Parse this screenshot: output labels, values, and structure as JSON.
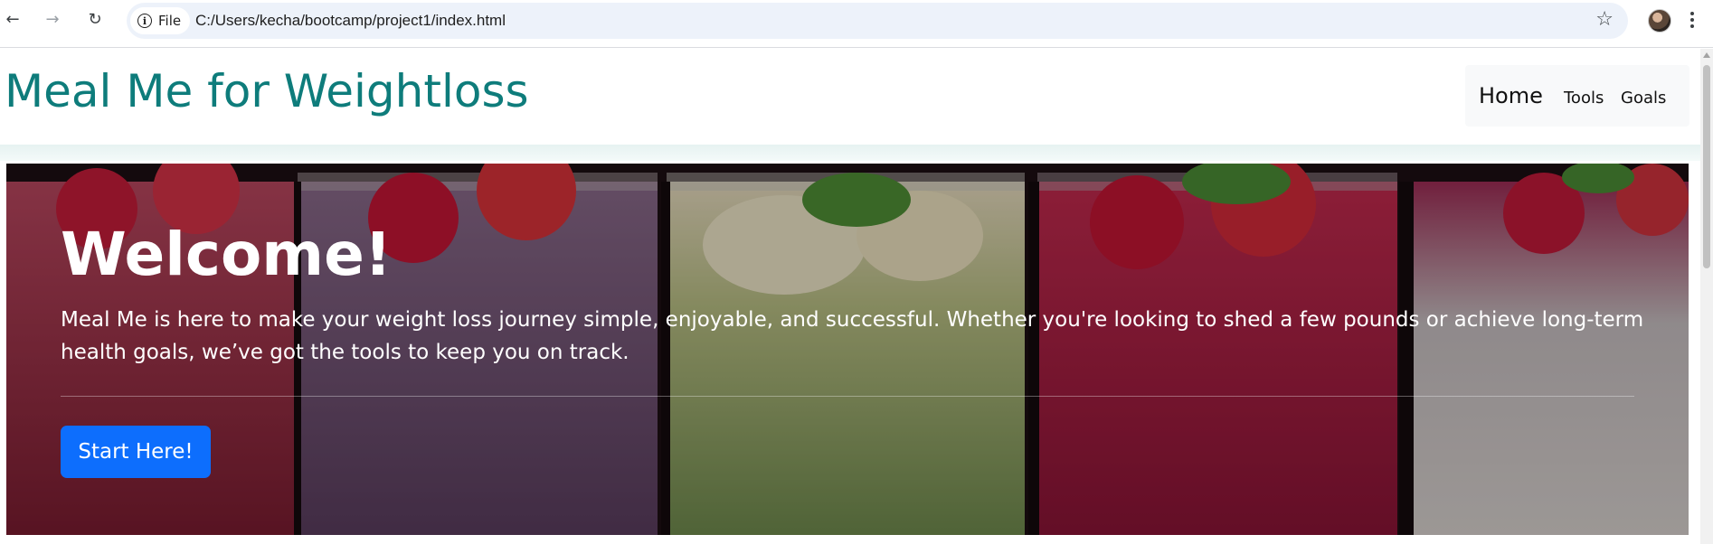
{
  "browser": {
    "back_icon": "arrow-left-icon",
    "forward_icon": "arrow-right-icon",
    "reload_icon": "reload-icon",
    "file_chip_label": "File",
    "url": "C:/Users/kecha/bootcamp/project1/index.html",
    "bookmark_icon": "star-icon",
    "menu_icon": "kebab-menu-icon"
  },
  "site": {
    "title": "Meal Me for Weightloss",
    "title_color": "#0e7c7b",
    "nav": {
      "home": "Home",
      "tools": "Tools",
      "goals": "Goals"
    }
  },
  "hero": {
    "heading": "Welcome!",
    "text": "Meal Me is here to make your weight loss journey simple, enjoyable, and successful. Whether you're looking to shed a few pounds or achieve long-term health goals, we’ve got the tools to keep you on track.",
    "button_label": "Start Here!",
    "button_color": "#0d6efd"
  }
}
